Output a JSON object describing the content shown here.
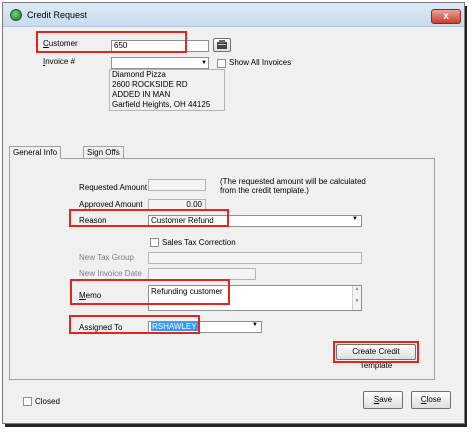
{
  "window": {
    "title": "Credit Request",
    "close_label": "x"
  },
  "header": {
    "customer_label": "Customer",
    "customer_value": "650",
    "invoice_label": "Invoice #",
    "invoice_value": "",
    "show_all_invoices_label": "Show All Invoices",
    "address_lines": [
      "Diamond Pizza",
      "2600 ROCKSIDE RD",
      "ADDED IN MAN",
      "Garfield Heights, OH  44125"
    ]
  },
  "tabs": [
    {
      "label": "General Info",
      "active": true
    },
    {
      "label": "Sign Offs",
      "active": false
    }
  ],
  "general": {
    "requested_amount_label": "Requested Amount",
    "requested_amount_value": "",
    "requested_note": "(The requested amount will be calculated\nfrom the credit template.)",
    "approved_amount_label": "Approved Amount",
    "approved_amount_value": "0.00",
    "reason_label": "Reason",
    "reason_value": "Customer Refund",
    "sales_tax_label": "Sales Tax Correction",
    "new_tax_group_label": "New Tax Group",
    "new_invoice_date_label": "New Invoice Date",
    "memo_label": "Memo",
    "memo_value": "Refunding customer",
    "assigned_to_label": "Assigned To",
    "assigned_to_value": "RSHAWLEY",
    "create_template_label": "Create Credit Template"
  },
  "footer": {
    "closed_label": "Closed",
    "save_label": "Save",
    "close_label": "Close"
  },
  "colors": {
    "highlight_red": "#e3261b",
    "selection_blue": "#3399ff"
  }
}
